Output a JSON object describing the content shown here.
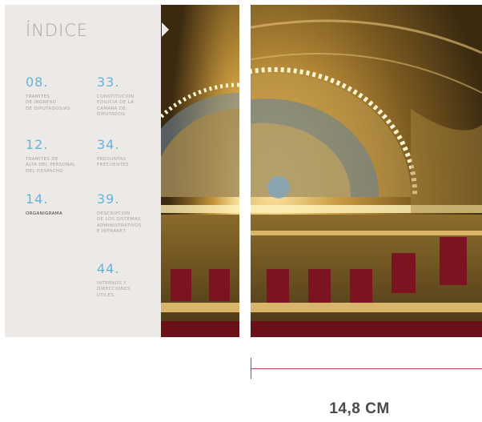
{
  "index": {
    "title": "ÍNDICE",
    "entries": [
      {
        "number": "08.",
        "text": "TRAMITES\nDE INGRESO\nDE DIPUTADOS/AS"
      },
      {
        "number": "33.",
        "text": "CONSTITUCION\nEDILICIA DE LA\nCAMARA DE\nDIPUTADOS"
      },
      {
        "number": "12.",
        "text": "TRAMITES DE\nALTA DEL PERSONAL\nDEL DESPACHO"
      },
      {
        "number": "34.",
        "text": "PREGUNTAS\nFRECUENTES"
      },
      {
        "number": "14.",
        "text": "ORGANIGRAMA"
      },
      {
        "number": "39.",
        "text": "DESCRIPCION\nDE LOS SISTEMAS\nADMINISTRATIVOS\nE INTRANET"
      },
      {
        "number": "44.",
        "text": "INTERNOS Y\nDIRECCIONES\nUTILES"
      }
    ]
  },
  "dimension": {
    "label": "14,8 CM",
    "color": "#d23a48"
  },
  "colors": {
    "page_background": "#ece9e6",
    "number_accent": "#66b3da",
    "muted_text": "#a9a6a2"
  },
  "photo": {
    "subject": "ornate gilded domed ceiling of the Chamber of Deputies hall"
  }
}
